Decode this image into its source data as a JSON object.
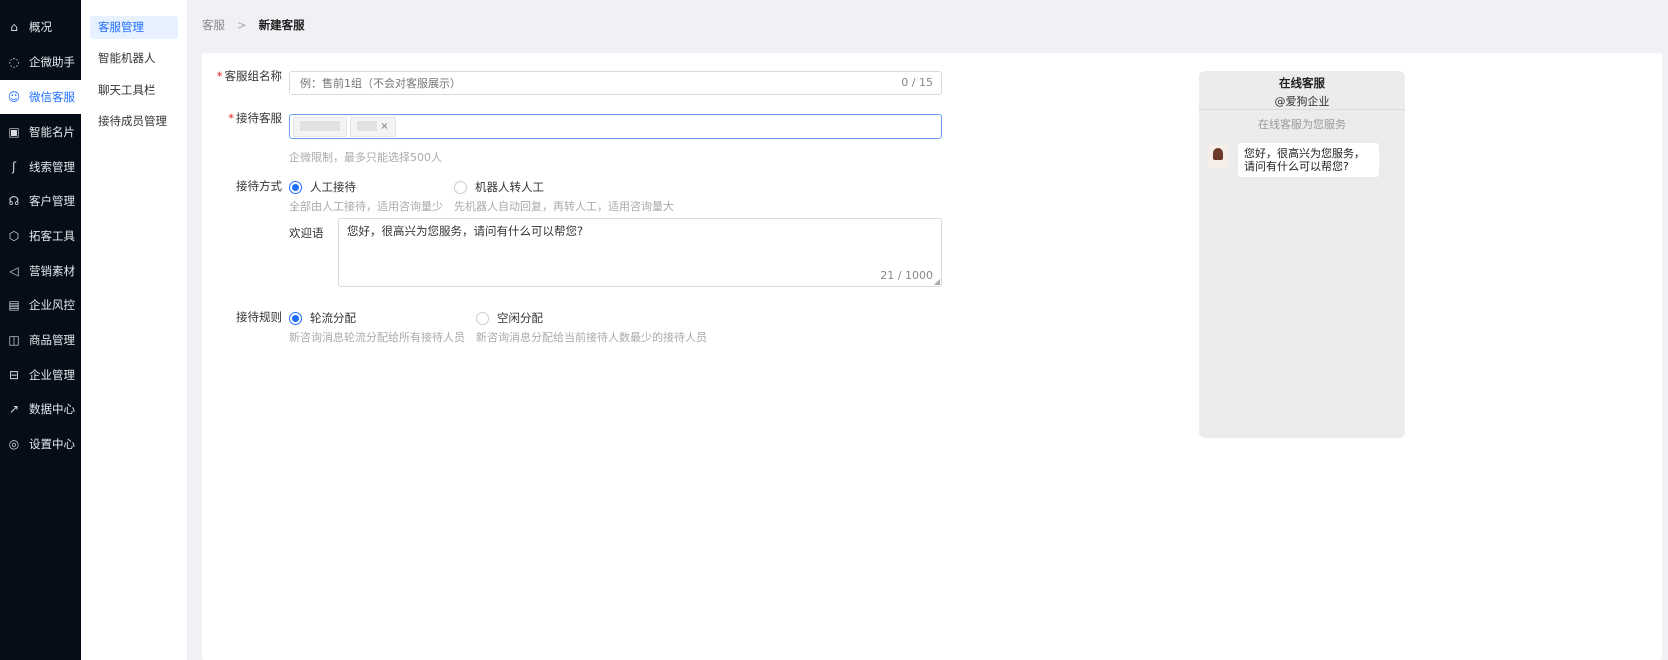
{
  "sidebar": {
    "items": [
      {
        "label": "概况",
        "icon": "home-icon"
      },
      {
        "label": "企微助手",
        "icon": "chat-search-icon"
      },
      {
        "label": "微信客服",
        "icon": "wechat-service-icon",
        "active": true
      },
      {
        "label": "智能名片",
        "icon": "card-icon"
      },
      {
        "label": "线索管理",
        "icon": "path-icon"
      },
      {
        "label": "客户管理",
        "icon": "users-icon"
      },
      {
        "label": "拓客工具",
        "icon": "handshake-icon"
      },
      {
        "label": "营销素材",
        "icon": "megaphone-icon"
      },
      {
        "label": "企业风控",
        "icon": "message-box-icon"
      },
      {
        "label": "商品管理",
        "icon": "bag-icon"
      },
      {
        "label": "企业管理",
        "icon": "briefcase-icon"
      },
      {
        "label": "数据中心",
        "icon": "line-chart-icon"
      },
      {
        "label": "设置中心",
        "icon": "settings-icon"
      }
    ]
  },
  "subnav": {
    "items": [
      {
        "label": "客服管理",
        "active": true
      },
      {
        "label": "智能机器人"
      },
      {
        "label": "聊天工具栏"
      },
      {
        "label": "接待成员管理"
      }
    ]
  },
  "breadcrumb": {
    "parent": "客服",
    "separator": ">",
    "current": "新建客服"
  },
  "form": {
    "name": {
      "label": "客服组名称",
      "placeholder": "例：售前1组（不会对客服展示）",
      "count": "0 / 15"
    },
    "agents": {
      "label": "接待客服",
      "hint": "企微限制，最多只能选择500人",
      "remove": "×"
    },
    "mode": {
      "label": "接待方式",
      "options": [
        {
          "label": "人工接待",
          "desc": "全部由人工接待，适用咨询量少",
          "selected": true
        },
        {
          "label": "机器人转人工",
          "desc": "先机器人自动回复，再转人工，适用咨询量大",
          "selected": false
        }
      ]
    },
    "welcome": {
      "label": "欢迎语",
      "value": "您好，很高兴为您服务，请问有什么可以帮您?",
      "count": "21 / 1000"
    },
    "rule": {
      "label": "接待规则",
      "options": [
        {
          "label": "轮流分配",
          "desc": "新咨询消息轮流分配给所有接待人员",
          "selected": true
        },
        {
          "label": "空闲分配",
          "desc": "新咨询消息分配给当前接待人数最少的接待人员",
          "selected": false
        }
      ]
    }
  },
  "preview": {
    "title": "在线客服",
    "subtitle": "@爱狗企业",
    "notice": "在线客服为您服务",
    "message": "您好，很高兴为您服务，请问有什么可以帮您?"
  },
  "colors": {
    "accent": "#1f6fff",
    "sidebar": "#050d18"
  }
}
